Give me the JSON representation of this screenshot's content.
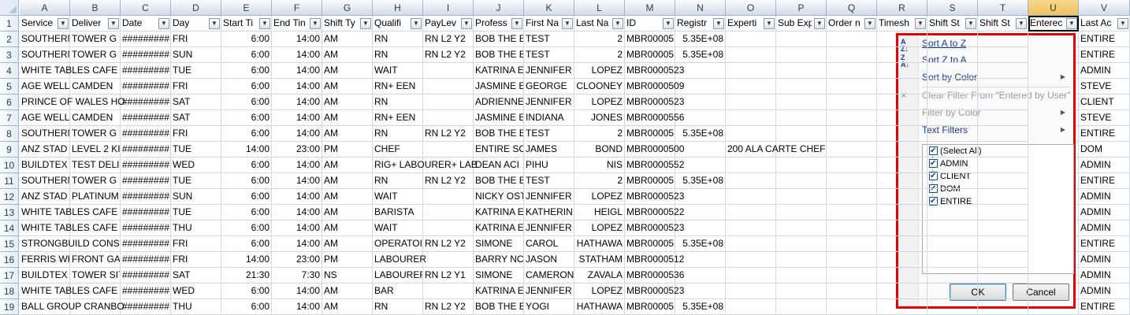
{
  "columns": [
    "A",
    "B",
    "C",
    "D",
    "E",
    "F",
    "G",
    "H",
    "I",
    "J",
    "K",
    "L",
    "M",
    "N",
    "O",
    "P",
    "Q",
    "R",
    "S",
    "T",
    "U",
    "V"
  ],
  "active_column": "U",
  "headers": [
    "Service",
    "Deliver",
    "Date",
    "Day",
    "Start Ti",
    "End Tin",
    "Shift Ty",
    "Qualifi",
    "PayLev",
    "Profess",
    "First Na",
    "Last Na",
    "ID",
    "Registr",
    "Experti",
    "Sub Exp",
    "Order n",
    "Timesh",
    "Shift St",
    "Shift St",
    "Enterec",
    "Last Ac"
  ],
  "row_numbers": [
    "1",
    "2",
    "3",
    "4",
    "5",
    "6",
    "7",
    "8",
    "9",
    "10",
    "11",
    "12",
    "13",
    "14",
    "15",
    "16",
    "17",
    "18",
    "19"
  ],
  "rows": [
    [
      "SOUTHERN",
      "TOWER G",
      "#########",
      "FRI",
      "6:00",
      "14:00",
      "AM",
      "RN",
      "RN L2 Y2",
      "BOB THE E",
      "TEST",
      "2",
      "MBR00005",
      "5.35E+08",
      "",
      "",
      "",
      "",
      "",
      "",
      "",
      "ENTIRE"
    ],
    [
      "SOUTHERN",
      "TOWER G",
      "#########",
      "SUN",
      "6:00",
      "14:00",
      "AM",
      "RN",
      "RN L2 Y2",
      "BOB THE E",
      "TEST",
      "2",
      "MBR00005",
      "5.35E+08",
      "",
      "",
      "",
      "",
      "",
      "",
      "",
      "ENTIRE"
    ],
    [
      "WHITE TABLES CAFE",
      "",
      "#########",
      "TUE",
      "6:00",
      "14:00",
      "AM",
      "WAIT",
      "",
      "KATRINA E",
      "JENNIFER",
      "LOPEZ",
      "MBR0000523",
      "",
      "",
      "",
      "",
      "",
      "",
      "",
      "",
      "ADMIN"
    ],
    [
      "AGE WELL CAMDEN",
      "",
      "#########",
      "FRI",
      "6:00",
      "14:00",
      "AM",
      "RN+ EEN",
      "",
      "JASMINE E",
      "GEORGE",
      "CLOONEY",
      "MBR0000509",
      "",
      "",
      "",
      "",
      "",
      "",
      "",
      "",
      "STEVE"
    ],
    [
      "PRINCE OF WALES HO",
      "",
      "#########",
      "SAT",
      "6:00",
      "14:00",
      "AM",
      "RN",
      "",
      "ADRIENNE",
      "JENNIFER",
      "LOPEZ",
      "MBR0000523",
      "",
      "",
      "",
      "",
      "",
      "",
      "",
      "",
      "CLIENT"
    ],
    [
      "AGE WELL CAMDEN",
      "",
      "#########",
      "SAT",
      "6:00",
      "14:00",
      "AM",
      "RN+ EEN",
      "",
      "JASMINE E",
      "INDIANA",
      "JONES",
      "MBR0000556",
      "",
      "",
      "",
      "",
      "",
      "",
      "",
      "",
      "STEVE"
    ],
    [
      "SOUTHERN",
      "TOWER G",
      "#########",
      "FRI",
      "6:00",
      "14:00",
      "AM",
      "RN",
      "RN L2 Y2",
      "BOB THE E",
      "TEST",
      "2",
      "MBR00005",
      "5.35E+08",
      "",
      "",
      "",
      "",
      "",
      "",
      "",
      "ENTIRE"
    ],
    [
      "ANZ STAD",
      "LEVEL 2 KIT",
      "#########",
      "TUE",
      "14:00",
      "23:00",
      "PM",
      "CHEF",
      "",
      "ENTIRE SC",
      "JAMES",
      "BOND",
      "MBR0000500",
      "",
      "200 ALA CARTE CHEF",
      "",
      "",
      "",
      "",
      "",
      "",
      "DOM"
    ],
    [
      "BUILDTEX",
      "TEST DELIV",
      "#########",
      "WED",
      "6:00",
      "14:00",
      "AM",
      "RIG+ LABOURER+ LAB",
      "",
      "DEAN ACI",
      "PIHU",
      "NIS",
      "MBR0000552",
      "",
      "",
      "",
      "",
      "",
      "",
      "",
      "",
      "ADMIN"
    ],
    [
      "SOUTHERN",
      "TOWER G",
      "#########",
      "TUE",
      "6:00",
      "14:00",
      "AM",
      "RN",
      "RN L2 Y2",
      "BOB THE E",
      "TEST",
      "2",
      "MBR00005",
      "5.35E+08",
      "",
      "",
      "",
      "",
      "",
      "",
      "",
      "ENTIRE"
    ],
    [
      "ANZ STAD",
      "PLATINUM",
      "#########",
      "SUN",
      "6:00",
      "14:00",
      "AM",
      "WAIT",
      "",
      "NICKY OST",
      "JENNIFER",
      "LOPEZ",
      "MBR0000523",
      "",
      "",
      "",
      "",
      "",
      "",
      "",
      "",
      "ADMIN"
    ],
    [
      "WHITE TABLES CAFE",
      "",
      "#########",
      "TUE",
      "6:00",
      "14:00",
      "AM",
      "BARISTA",
      "",
      "KATRINA E",
      "KATHERIN",
      "HEIGL",
      "MBR0000522",
      "",
      "",
      "",
      "",
      "",
      "",
      "",
      "",
      "ADMIN"
    ],
    [
      "WHITE TABLES CAFE",
      "",
      "#########",
      "THU",
      "6:00",
      "14:00",
      "AM",
      "WAIT",
      "",
      "KATRINA E",
      "JENNIFER",
      "LOPEZ",
      "MBR0000523",
      "",
      "",
      "",
      "",
      "",
      "",
      "",
      "",
      "ADMIN"
    ],
    [
      "STRONGBUILD CONS",
      "",
      "#########",
      "FRI",
      "6:00",
      "14:00",
      "AM",
      "OPERATOI",
      "RN L2 Y2",
      "SIMONE",
      "CAROL",
      "HATHAWA",
      "MBR00005",
      "5.35E+08",
      "",
      "",
      "",
      "",
      "",
      "",
      "",
      "ENTIRE"
    ],
    [
      "FERRIS WH",
      "FRONT GA",
      "#########",
      "FRI",
      "14:00",
      "23:00",
      "PM",
      "LABOURER",
      "",
      "BARRY NC",
      "JASON",
      "STATHAM",
      "MBR0000512",
      "",
      "",
      "",
      "",
      "",
      "",
      "",
      "",
      "ADMIN"
    ],
    [
      "BUILDTEX",
      "TOWER SIT",
      "#########",
      "SAT",
      "21:30",
      "7:30",
      "NS",
      "LABOUREF",
      "RN L2 Y1",
      "SIMONE",
      "CAMERON",
      "ZAVALA",
      "MBR0000536",
      "",
      "",
      "",
      "",
      "",
      "",
      "",
      "",
      "ADMIN"
    ],
    [
      "WHITE TABLES CAFE",
      "",
      "#########",
      "WED",
      "6:00",
      "14:00",
      "AM",
      "BAR",
      "",
      "KATRINA E",
      "JENNIFER",
      "LOPEZ",
      "MBR0000523",
      "",
      "",
      "",
      "",
      "",
      "",
      "",
      "",
      "ADMIN"
    ],
    [
      "BALL GROUP CRANBO",
      "",
      "#########",
      "THU",
      "6:00",
      "14:00",
      "AM",
      "RN",
      "RN L2 Y2",
      "BOB THE E",
      "YOGI",
      "HATHAWA",
      "MBR00005",
      "5.35E+08",
      "",
      "",
      "",
      "",
      "",
      "",
      "",
      "ENTIRE"
    ]
  ],
  "filter_menu": {
    "sort_az": "Sort A to Z",
    "sort_za": "Sort Z to A",
    "sort_color": "Sort by Color",
    "clear_filter": "Clear Filter From \"Entered by User\"",
    "filter_color": "Filter by Color",
    "text_filters": "Text Filters",
    "list": [
      "(Select All)",
      "ADMIN",
      "CLIENT",
      "DOM",
      "ENTIRE"
    ],
    "ok": "OK",
    "cancel": "Cancel",
    "border_color": "#e00000"
  }
}
